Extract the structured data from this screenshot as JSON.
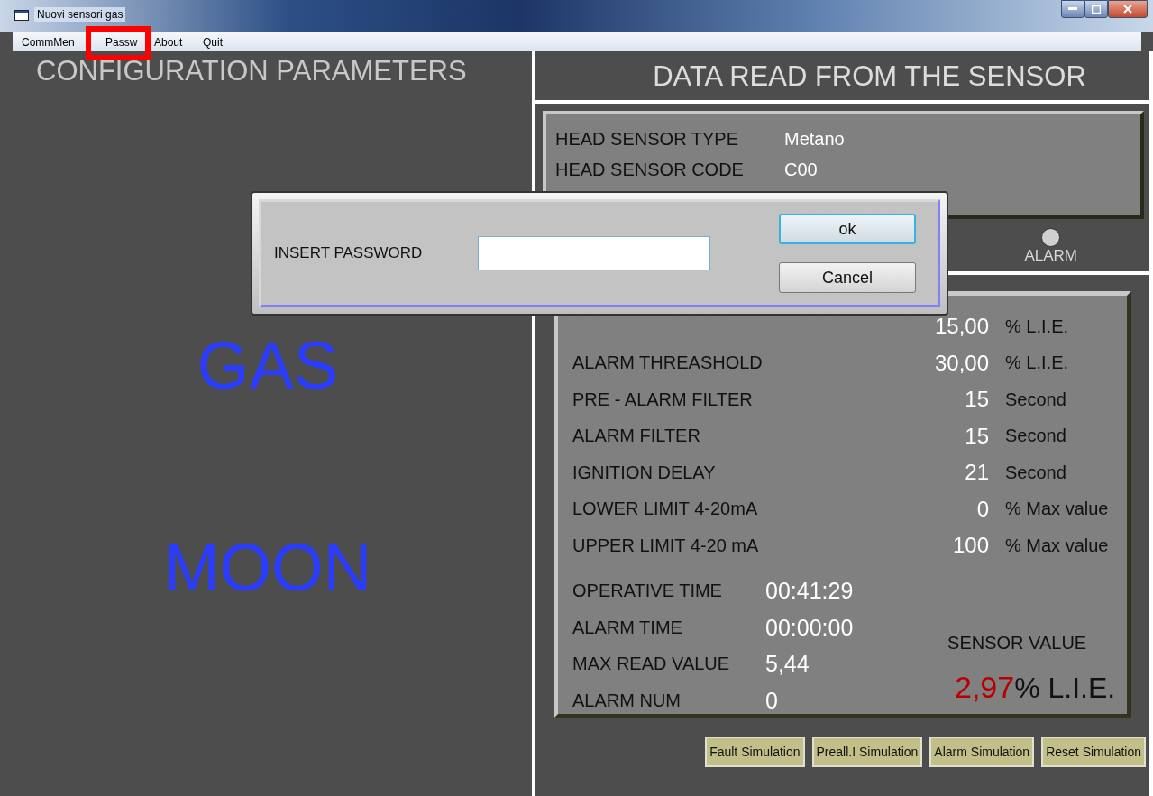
{
  "window": {
    "title": "Nuovi sensori gas"
  },
  "menu": [
    {
      "label": "CommMen"
    },
    {
      "label": "Passw"
    },
    {
      "label": "About"
    },
    {
      "label": "Quit"
    }
  ],
  "left": {
    "title": "CONFIGURATION PARAMETERS",
    "names": [
      "GAS",
      "MOON"
    ]
  },
  "right": {
    "title": "DATA READ FROM THE SENSOR",
    "info": [
      {
        "label": "HEAD SENSOR TYPE",
        "value": "Metano"
      },
      {
        "label": "HEAD SENSOR CODE",
        "value": "C00"
      }
    ],
    "indicators": [
      {
        "label": "ALARM",
        "on": false
      }
    ],
    "params": [
      {
        "value": "15,00",
        "unit": "% L.I.E."
      },
      {
        "label": "ALARM THREASHOLD",
        "value": "30,00",
        "unit": "% L.I.E."
      },
      {
        "label": "PRE - ALARM FILTER",
        "value": "15",
        "unit": "Second"
      },
      {
        "label": "ALARM FILTER",
        "value": "15",
        "unit": "Second"
      },
      {
        "label": "IGNITION DELAY",
        "value": "21",
        "unit": "Second"
      },
      {
        "label": "LOWER LIMIT 4-20mA",
        "value": "0",
        "unit": "% Max value"
      },
      {
        "label": "UPPER LIMIT 4-20 mA",
        "value": "100",
        "unit": "% Max value"
      }
    ],
    "counters": [
      {
        "label": "OPERATIVE TIME",
        "value": "00:41:29"
      },
      {
        "label": "ALARM TIME",
        "value": "00:00:00"
      },
      {
        "label": "MAX READ VALUE",
        "value": "5,44"
      },
      {
        "label": "ALARM NUM",
        "value": "0"
      }
    ],
    "sensor": {
      "label": "SENSOR VALUE",
      "value": "2,97",
      "unit": "% L.I.E."
    },
    "buttons": [
      "Fault Simulation",
      "Preall.I Simulation",
      "Alarm Simulation",
      "Reset Simulation"
    ]
  },
  "dialog": {
    "label": "INSERT PASSWORD",
    "buttons": [
      {
        "label": "ok",
        "focused": true
      },
      {
        "label": "Cancel",
        "focused": false
      }
    ]
  }
}
